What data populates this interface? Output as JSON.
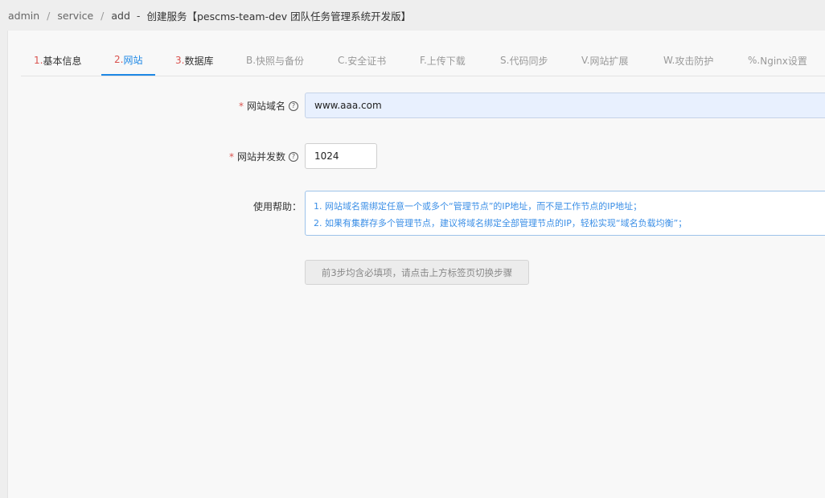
{
  "breadcrumb": {
    "items": [
      "admin",
      "service",
      "add"
    ],
    "separator": "/",
    "dash": "-",
    "subtitle": "创建服务【pescms-team-dev 团队任务管理系统开发版】"
  },
  "tabs": [
    {
      "num": "1.",
      "label": "基本信息",
      "state": "required"
    },
    {
      "num": "2.",
      "label": "网站",
      "state": "active"
    },
    {
      "num": "3.",
      "label": "数据库",
      "state": "required"
    },
    {
      "num": "B.",
      "label": "快照与备份",
      "state": "normal"
    },
    {
      "num": "C.",
      "label": "安全证书",
      "state": "normal"
    },
    {
      "num": "F.",
      "label": "上传下载",
      "state": "normal"
    },
    {
      "num": "S.",
      "label": "代码同步",
      "state": "normal"
    },
    {
      "num": "V.",
      "label": "网站扩展",
      "state": "normal"
    },
    {
      "num": "W.",
      "label": "攻击防护",
      "state": "normal"
    },
    {
      "num": "%.",
      "label": "Nginx设置",
      "state": "normal"
    }
  ],
  "form": {
    "domain": {
      "required_mark": "*",
      "label": "网站域名",
      "help_icon": "?",
      "value": "www.aaa.com"
    },
    "concurrency": {
      "required_mark": "*",
      "label": "网站并发数",
      "help_icon": "?",
      "value": "1024"
    },
    "help": {
      "label": "使用帮助：",
      "lines": [
        "1. 网站域名需绑定任意一个或多个“管理节点”的IP地址，而不是工作节点的IP地址；",
        "2. 如果有集群存多个管理节点，建议将域名绑定全部管理节点的IP，轻松实现“域名负载均衡”；"
      ]
    },
    "submit_label": "前3步均含必填项，请点击上方标签页切换步骤"
  },
  "colors": {
    "accent": "#1e88e5",
    "required": "#d9534f",
    "help_text": "#3a8ee6"
  }
}
